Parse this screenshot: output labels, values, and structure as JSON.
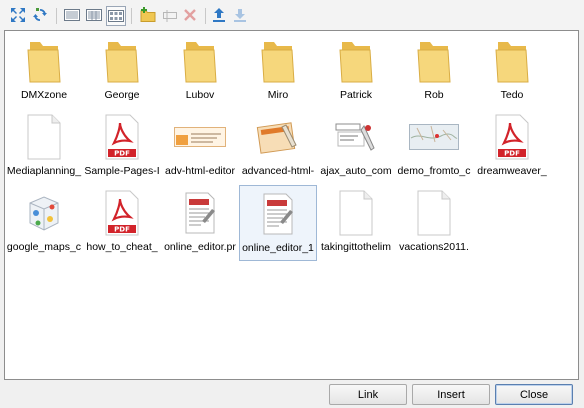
{
  "toolbar": {
    "buttons": [
      {
        "name": "fullscreen-icon",
        "enabled": true
      },
      {
        "name": "refresh-icon",
        "enabled": true
      },
      {
        "name": "list-view-icon",
        "enabled": true
      },
      {
        "name": "detail-view-icon",
        "enabled": true
      },
      {
        "name": "thumbnail-view-icon",
        "enabled": true,
        "active": true
      },
      {
        "name": "new-folder-icon",
        "enabled": true
      },
      {
        "name": "rename-icon",
        "enabled": false
      },
      {
        "name": "delete-icon",
        "enabled": false
      },
      {
        "name": "upload-icon",
        "enabled": true
      },
      {
        "name": "download-icon",
        "enabled": false
      }
    ]
  },
  "files": {
    "items": [
      {
        "label": "DMXzone",
        "type": "folder"
      },
      {
        "label": "George",
        "type": "folder"
      },
      {
        "label": "Lubov",
        "type": "folder"
      },
      {
        "label": "Miro",
        "type": "folder"
      },
      {
        "label": "Patrick",
        "type": "folder"
      },
      {
        "label": "Rob",
        "type": "folder"
      },
      {
        "label": "Tedo",
        "type": "folder"
      },
      {
        "label": "Mediaplanning_",
        "type": "blank"
      },
      {
        "label": "Sample-Pages-I",
        "type": "pdf"
      },
      {
        "label": "adv-html-editor",
        "type": "image-banner"
      },
      {
        "label": "advanced-html-",
        "type": "image-box"
      },
      {
        "label": "ajax_auto_com",
        "type": "image-ajax"
      },
      {
        "label": "demo_fromto_c",
        "type": "image-map"
      },
      {
        "label": "dreamweaver_",
        "type": "pdf"
      },
      {
        "label": "google_maps_c",
        "type": "image-cube"
      },
      {
        "label": "how_to_cheat_",
        "type": "pdf"
      },
      {
        "label": "online_editor.pr",
        "type": "editor"
      },
      {
        "label": "online_editor_1",
        "type": "editor",
        "selected": true
      },
      {
        "label": "takingittothelim",
        "type": "blank"
      },
      {
        "label": "vacations2011.",
        "type": "blank"
      }
    ]
  },
  "footer": {
    "link_label": "Link",
    "insert_label": "Insert",
    "close_label": "Close"
  },
  "colors": {
    "folder": "#f3d271",
    "pdf_red": "#d2232a",
    "selection": "#eef4fb",
    "toolbar_blue": "#3a7fc8"
  }
}
